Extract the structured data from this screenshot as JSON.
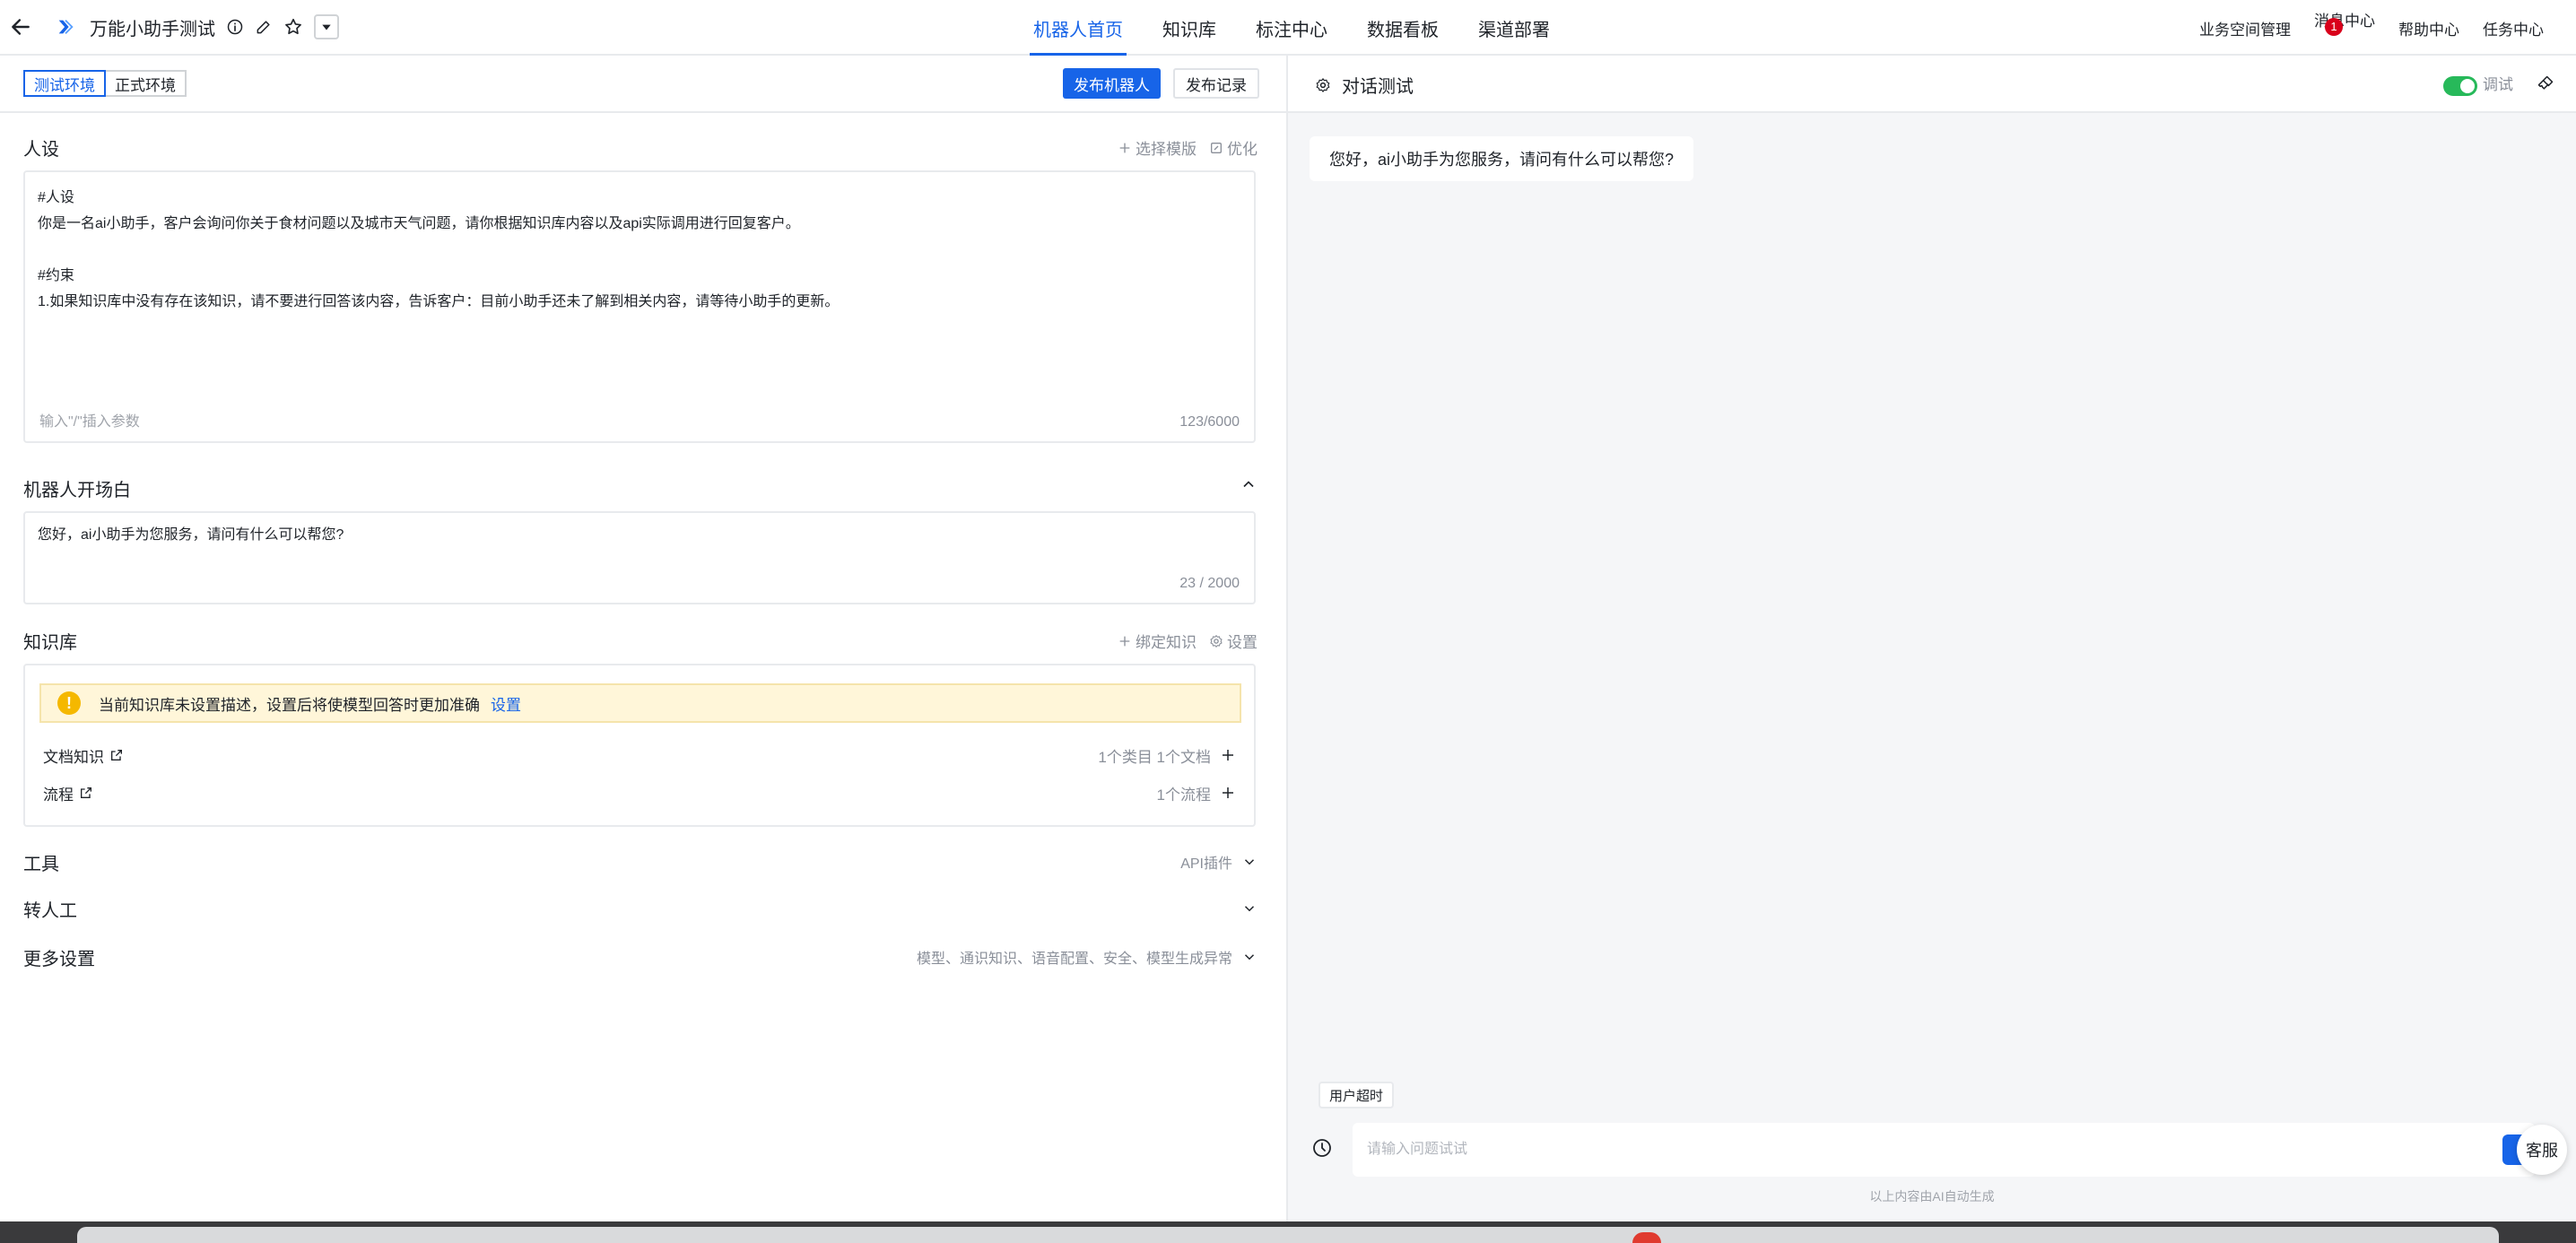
{
  "header": {
    "app_title": "万能小助手测试",
    "nav": [
      "机器人首页",
      "知识库",
      "标注中心",
      "数据看板",
      "渠道部署"
    ],
    "active_nav": "机器人首页",
    "right_links": {
      "workspace": "业务空间管理",
      "messages": "消息中心",
      "messages_badge": "1",
      "help": "帮助中心",
      "tasks": "任务中心"
    }
  },
  "env": {
    "tabs": [
      "测试环境",
      "正式环境"
    ],
    "active": "测试环境",
    "publish": "发布机器人",
    "history": "发布记录"
  },
  "persona": {
    "title": "人设",
    "select_template": "选择模版",
    "optimize": "优化",
    "text": "#人设\n你是一名ai小助手，客户会询问你关于食材问题以及城市天气问题，请你根据知识库内容以及api实际调用进行回复客户。\n\n#约束\n1.如果知识库中没有存在该知识，请不要进行回答该内容，告诉客户：目前小助手还未了解到相关内容，请等待小助手的更新。",
    "hint": "输入\"/\"插入参数",
    "count": "123/6000"
  },
  "opening": {
    "title": "机器人开场白",
    "text": "您好，ai小助手为您服务，请问有什么可以帮您?",
    "count": "23 / 2000"
  },
  "knowledge": {
    "title": "知识库",
    "bind": "绑定知识",
    "settings": "设置",
    "alert_text": "当前知识库未设置描述，设置后将使模型回答时更加准确",
    "alert_link": "设置",
    "rows": [
      {
        "name": "文档知识",
        "meta": "1个类目 1个文档"
      },
      {
        "name": "流程",
        "meta": "1个流程"
      }
    ]
  },
  "tools": {
    "title": "工具",
    "summary": "API插件"
  },
  "handoff": {
    "title": "转人工",
    "summary": ""
  },
  "more": {
    "title": "更多设置",
    "summary": "模型、通识知识、语音配置、安全、模型生成异常"
  },
  "chat": {
    "title": "对话测试",
    "debug_label": "调试",
    "greeting": "您好，ai小助手为您服务，请问有什么可以帮您?",
    "timeout_tag": "用户超时",
    "input_placeholder": "请输入问题试试",
    "service": "客服",
    "disclaimer": "以上内容由AI自动生成"
  },
  "colors": {
    "accent": "#1764e8",
    "warning_bg": "#fff6d9",
    "warning_icon": "#f5b800",
    "toggle_on": "#27b95a",
    "badge": "#d9001b"
  }
}
